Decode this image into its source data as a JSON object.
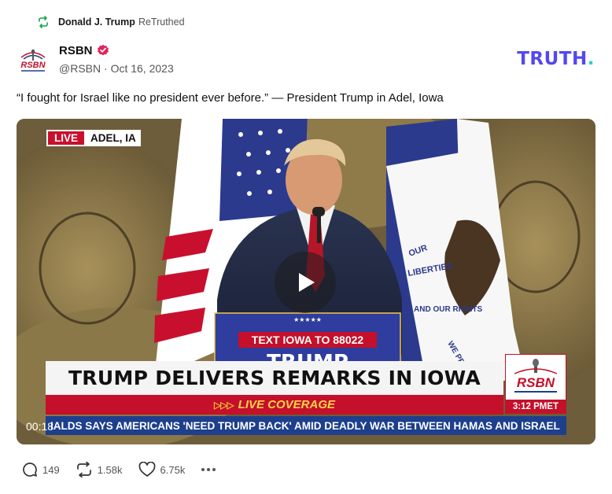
{
  "retruth": {
    "user": "Donald J. Trump",
    "label": "ReTruthed",
    "icon": "retruth-icon"
  },
  "post": {
    "author": "RSBN",
    "handle": "@RSBN",
    "separator": "·",
    "date": "Oct 16, 2023",
    "text": "“I fought for Israel like no president ever before.” — President Trump in Adel, Iowa"
  },
  "brand": {
    "text": "TRUTH",
    "dot": ".",
    "color": "#5448ee",
    "dot_color": "#2ad1c5"
  },
  "video": {
    "live": "LIVE",
    "location": "ADEL, IA",
    "podium_text": "TEXT IOWA TO 88022",
    "podium_big": "TRUMP",
    "headline": "TRUMP DELIVERS REMARKS IN IOWA",
    "coverage": "LIVE COVERAGE",
    "ticker": "IALDS SAYS AMERICANS 'NEED TRUMP BACK' AMID DEADLY WAR BETWEEN HAMAS AND ISRAEL",
    "rsbn_logo": "RSBN",
    "time": "3:12 PMET",
    "duration": "00:18",
    "flag_text_1": "OUR",
    "flag_text_2": "LIBERTIES",
    "flag_text_3": "WE PRIZE",
    "flag_text_4": "AND OUR RIGHTS"
  },
  "actions": {
    "replies": "149",
    "retruths": "1.58k",
    "likes": "6.75k"
  },
  "colors": {
    "live_red": "#c8102e",
    "ticker_blue": "#1d3f8c",
    "verified": "#e0245e"
  }
}
